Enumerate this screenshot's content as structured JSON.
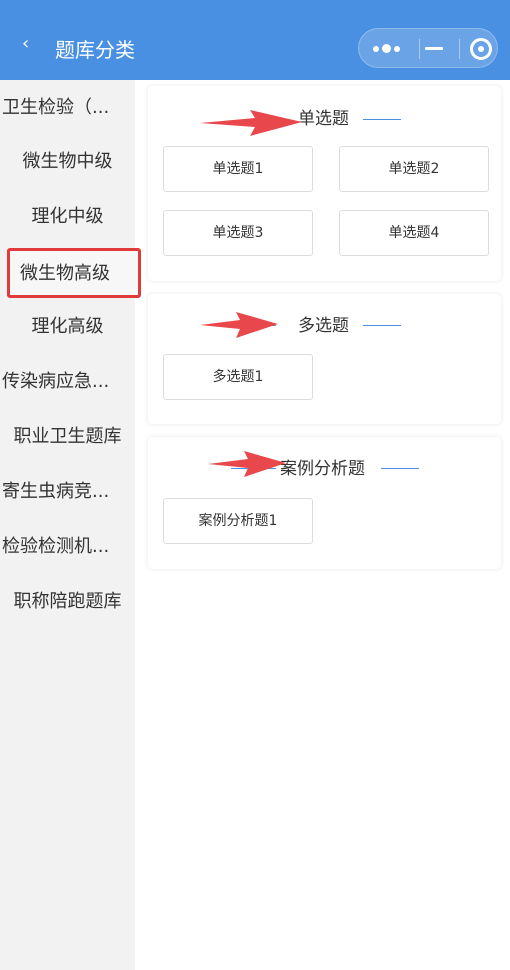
{
  "header": {
    "title": "题库分类",
    "back_glyph": "‹",
    "bg_color": "#4a90e2"
  },
  "sidebar": {
    "items": [
      {
        "label": "卫生检验（..."
      },
      {
        "label": "微生物中级"
      },
      {
        "label": "理化中级"
      },
      {
        "label": "微生物高级"
      },
      {
        "label": "理化高级"
      },
      {
        "label": "传染病应急..."
      },
      {
        "label": "职业卫生题库"
      },
      {
        "label": "寄生虫病竞..."
      },
      {
        "label": "检验检测机..."
      },
      {
        "label": "职称陪跑题库"
      }
    ],
    "selected_index": 3,
    "highlight_color": "#e03a3a"
  },
  "sections": [
    {
      "title": "单选题",
      "buttons": [
        "单选题1",
        "单选题2",
        "单选题3",
        "单选题4"
      ]
    },
    {
      "title": "多选题",
      "buttons": [
        "多选题1"
      ]
    },
    {
      "title": "案例分析题",
      "buttons": [
        "案例分析题1"
      ]
    }
  ],
  "icons": [
    "back-arrow-icon",
    "more-dots-icon",
    "minimize-icon",
    "target-icon",
    "red-arrow-icon"
  ],
  "accent_color": "#4a90e2",
  "annotation_color": "#e8474b"
}
